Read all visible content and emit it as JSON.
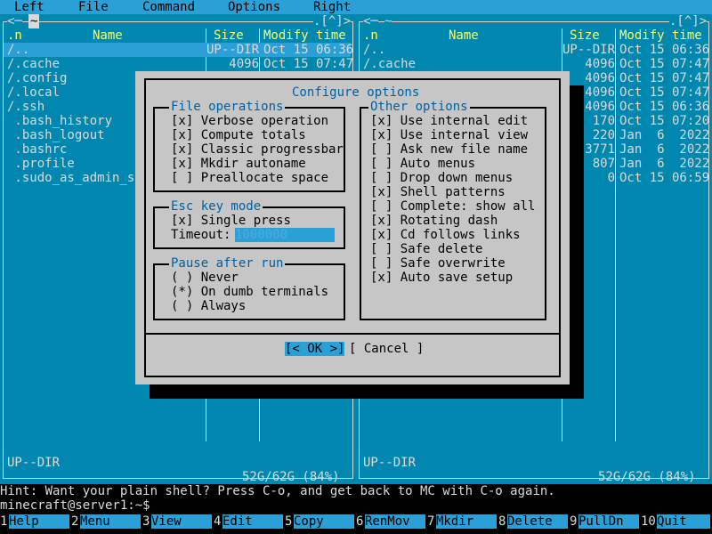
{
  "menubar": {
    "items": [
      "Left",
      "File",
      "Command",
      "Options",
      "Right"
    ]
  },
  "left_panel": {
    "path": "~",
    "corner": ".[^]>",
    "headers": {
      "sort": ".n",
      "name": "Name",
      "size": "Size",
      "mtime": "Modify time"
    },
    "rows": [
      {
        "name": "/..",
        "size": "UP--DIR",
        "mtime": "Oct 15 06:36"
      },
      {
        "name": "/.cache",
        "size": "4096",
        "mtime": "Oct 15 07:47"
      },
      {
        "name": "/.config",
        "size": "",
        "mtime": ""
      },
      {
        "name": "/.local",
        "size": "",
        "mtime": ""
      },
      {
        "name": "/.ssh",
        "size": "",
        "mtime": ""
      },
      {
        "name": " .bash_history",
        "size": "",
        "mtime": ""
      },
      {
        "name": " .bash_logout",
        "size": "",
        "mtime": ""
      },
      {
        "name": " .bashrc",
        "size": "",
        "mtime": ""
      },
      {
        "name": " .profile",
        "size": "",
        "mtime": ""
      },
      {
        "name": " .sudo_as_admin_su",
        "size": "",
        "mtime": ""
      }
    ],
    "status": "UP--DIR",
    "disk": "52G/62G (84%)"
  },
  "right_panel": {
    "path": "~",
    "corner": ".[^]>",
    "left_corner": "<─",
    "headers": {
      "sort": ".n",
      "name": "Name",
      "size": "Size",
      "mtime": "Modify time"
    },
    "rows": [
      {
        "name": "/..",
        "size": "UP--DIR",
        "mtime": "Oct 15 06:36"
      },
      {
        "name": "/.cache",
        "size": "4096",
        "mtime": "Oct 15 07:47"
      },
      {
        "name": "",
        "size": "4096",
        "mtime": "Oct 15 07:47"
      },
      {
        "name": "",
        "size": "4096",
        "mtime": "Oct 15 07:47"
      },
      {
        "name": "",
        "size": "4096",
        "mtime": "Oct 15 06:36"
      },
      {
        "name": "",
        "size": "170",
        "mtime": "Oct 15 07:20"
      },
      {
        "name": "",
        "size": "220",
        "mtime": "Jan  6  2022"
      },
      {
        "name": "",
        "size": "3771",
        "mtime": "Jan  6  2022"
      },
      {
        "name": "",
        "size": "807",
        "mtime": "Jan  6  2022"
      },
      {
        "name": "",
        "size": "0",
        "mtime": "Oct 15 06:59"
      }
    ],
    "status": "UP--DIR",
    "disk": "52G/62G (84%)"
  },
  "dialog": {
    "title": "Configure options",
    "file_ops": {
      "legend": "File operations",
      "items": [
        {
          "mark": "[x]",
          "label": "Verbose operation"
        },
        {
          "mark": "[x]",
          "label": "Compute totals"
        },
        {
          "mark": "[x]",
          "label": "Classic progressbar"
        },
        {
          "mark": "[x]",
          "label": "Mkdir autoname"
        },
        {
          "mark": "[ ]",
          "label": "Preallocate space"
        }
      ]
    },
    "esc": {
      "legend": "Esc key mode",
      "single": {
        "mark": "[x]",
        "label": "Single press"
      },
      "timeout_label": "Timeout:",
      "timeout_value": "1000000"
    },
    "pause": {
      "legend": "Pause after run",
      "items": [
        {
          "mark": "( )",
          "label": "Never"
        },
        {
          "mark": "(*)",
          "label": "On dumb terminals"
        },
        {
          "mark": "( )",
          "label": "Always"
        }
      ]
    },
    "other": {
      "legend": "Other options",
      "items": [
        {
          "mark": "[x]",
          "label": "Use internal edit"
        },
        {
          "mark": "[x]",
          "label": "Use internal view"
        },
        {
          "mark": "[ ]",
          "label": "Ask new file name"
        },
        {
          "mark": "[ ]",
          "label": "Auto menus"
        },
        {
          "mark": "[ ]",
          "label": "Drop down menus"
        },
        {
          "mark": "[x]",
          "label": "Shell patterns"
        },
        {
          "mark": "[ ]",
          "label": "Complete: show all"
        },
        {
          "mark": "[x]",
          "label": "Rotating dash"
        },
        {
          "mark": "[x]",
          "label": "Cd follows links"
        },
        {
          "mark": "[ ]",
          "label": "Safe delete"
        },
        {
          "mark": "[ ]",
          "label": "Safe overwrite"
        },
        {
          "mark": "[x]",
          "label": "Auto save setup"
        }
      ]
    },
    "ok_label": "[< OK >]",
    "cancel_label": "[ Cancel ]"
  },
  "hint": "Hint: Want your plain shell? Press C-o, and get back to MC with C-o again.",
  "prompt": "minecraft@server1:~$",
  "fkeys": [
    {
      "num": "1",
      "label": "Help"
    },
    {
      "num": "2",
      "label": "Menu"
    },
    {
      "num": "3",
      "label": "View"
    },
    {
      "num": "4",
      "label": "Edit"
    },
    {
      "num": "5",
      "label": "Copy"
    },
    {
      "num": "6",
      "label": "RenMov"
    },
    {
      "num": "7",
      "label": "Mkdir"
    },
    {
      "num": "8",
      "label": "Delete"
    },
    {
      "num": "9",
      "label": "PullDn"
    },
    {
      "num": "10",
      "label": "Quit"
    }
  ]
}
